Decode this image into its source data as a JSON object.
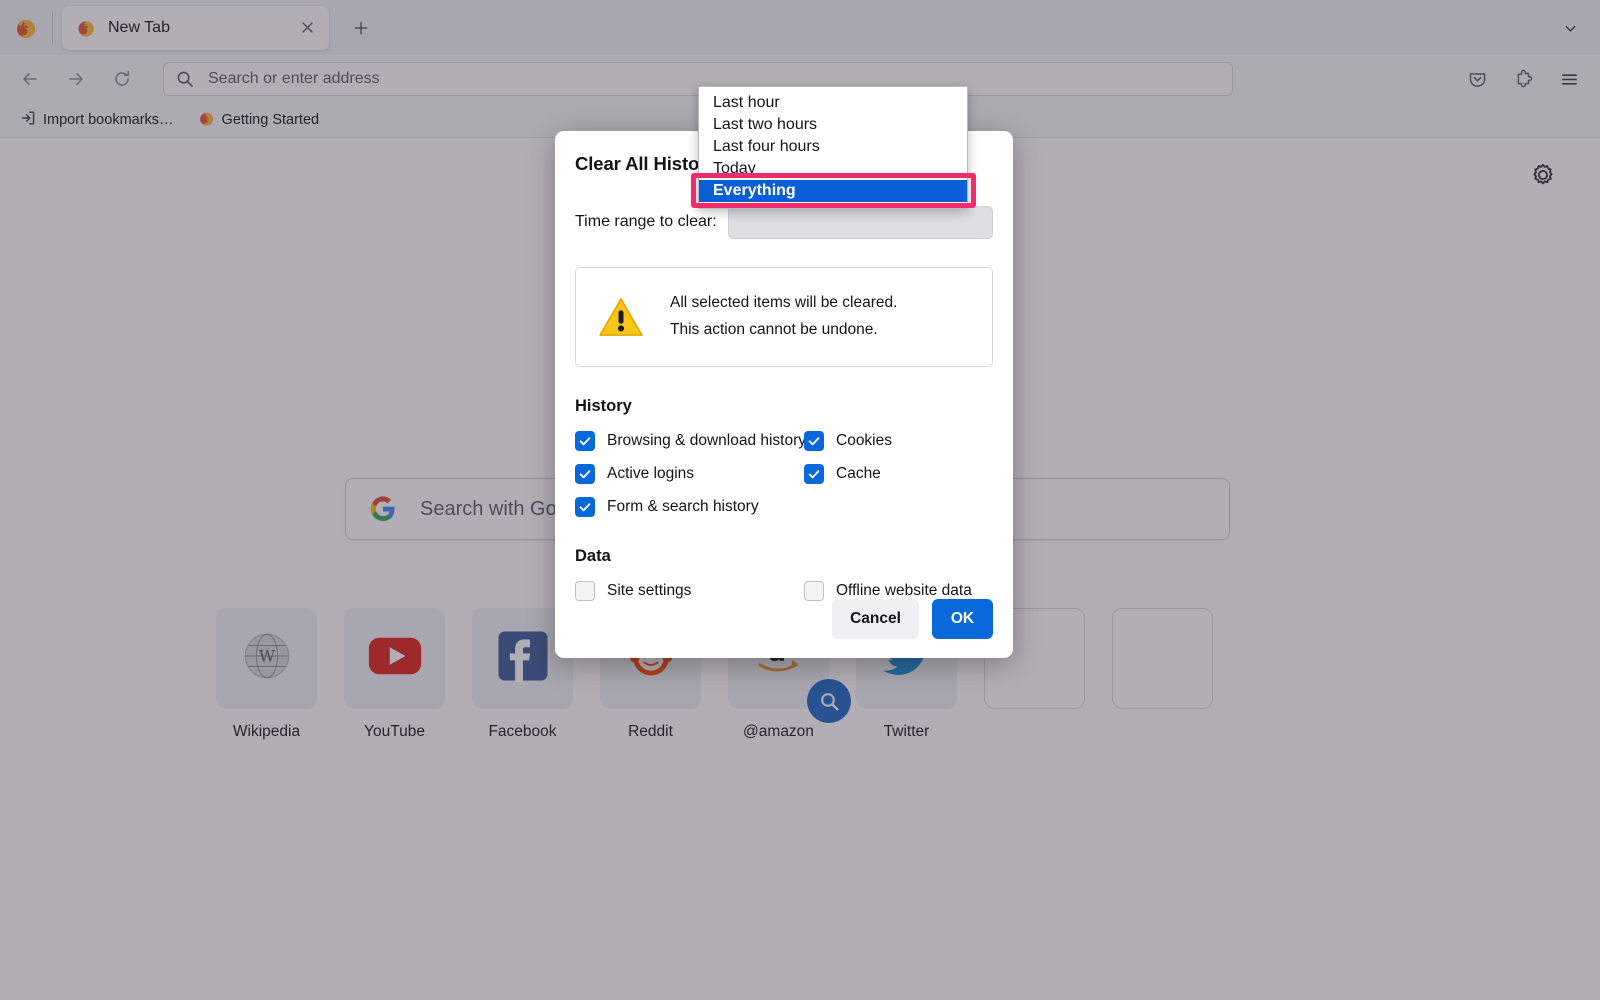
{
  "browser": {
    "app_logo": "firefox-logo",
    "tab": {
      "favicon": "firefox-favicon",
      "title": "New Tab",
      "close": "×"
    },
    "new_tab_button": "+",
    "tab_list_chevron": "chevron-down-icon",
    "nav": {
      "back": "back-arrow-icon",
      "forward": "forward-arrow-icon",
      "reload": "reload-icon"
    },
    "urlbar": {
      "icon": "search-icon",
      "placeholder": "Search or enter address",
      "value": ""
    },
    "toolbar_right": [
      {
        "name": "pocket-icon",
        "label": "Save to Pocket"
      },
      {
        "name": "extensions-icon",
        "label": "Extensions"
      },
      {
        "name": "hamburger-menu-icon",
        "label": "Open application menu"
      }
    ],
    "bookmarks": [
      {
        "icon": "import-icon",
        "label": "Import bookmarks…"
      },
      {
        "icon": "firefox-favicon",
        "label": "Getting Started"
      }
    ]
  },
  "newtab": {
    "settings_icon": "gear-icon",
    "search": {
      "engine_icon": "google-g-icon",
      "placeholder": "Search with Google or enter address"
    },
    "tiles": [
      {
        "label": "Wikipedia",
        "icon": "wikipedia-icon",
        "empty": false,
        "badge": null
      },
      {
        "label": "YouTube",
        "icon": "youtube-icon",
        "empty": false,
        "badge": null
      },
      {
        "label": "Facebook",
        "icon": "facebook-icon",
        "empty": false,
        "badge": null
      },
      {
        "label": "Reddit",
        "icon": "reddit-icon",
        "empty": false,
        "badge": null
      },
      {
        "label": "@amazon",
        "icon": "amazon-icon",
        "empty": false,
        "badge": "search-badge-icon"
      },
      {
        "label": "Twitter",
        "icon": "twitter-icon",
        "empty": false,
        "badge": null
      },
      {
        "label": "",
        "icon": "",
        "empty": true,
        "badge": null
      },
      {
        "label": "",
        "icon": "",
        "empty": true,
        "badge": null
      }
    ]
  },
  "dialog": {
    "title": "Clear All History",
    "time_range_label": "Time range to clear:",
    "time_range_value": "Everything",
    "warning": {
      "icon": "warning-triangle-icon",
      "line1": "All selected items will be cleared.",
      "line2": "This action cannot be undone."
    },
    "sections": [
      {
        "heading": "History",
        "items": [
          {
            "label": "Browsing & download history",
            "checked": true
          },
          {
            "label": "Cookies",
            "checked": true
          },
          {
            "label": "Active logins",
            "checked": true
          },
          {
            "label": "Cache",
            "checked": true
          },
          {
            "label": "Form & search history",
            "checked": true
          },
          {
            "label": "",
            "checked": false
          }
        ]
      },
      {
        "heading": "Data",
        "items": [
          {
            "label": "Site settings",
            "checked": false
          },
          {
            "label": "Offline website data",
            "checked": false
          }
        ]
      }
    ],
    "cancel_label": "Cancel",
    "ok_label": "OK"
  },
  "dropdown": {
    "options": [
      {
        "label": "Last hour",
        "selected": false
      },
      {
        "label": "Last two hours",
        "selected": false
      },
      {
        "label": "Last four hours",
        "selected": false
      },
      {
        "label": "Today",
        "selected": false
      },
      {
        "label": "Everything",
        "selected": true
      }
    ],
    "highlight_color": "#f42a6e",
    "selected_color": "#0a5ed7"
  }
}
